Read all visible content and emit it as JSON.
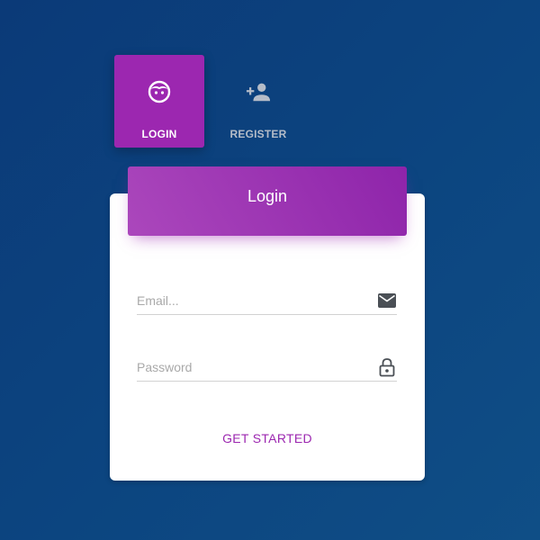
{
  "tabs": {
    "login": {
      "label": "LOGIN",
      "icon": "face-icon",
      "active": true
    },
    "register": {
      "label": "REGISTER",
      "icon": "person-add-icon",
      "active": false
    }
  },
  "card": {
    "title": "Login",
    "email": {
      "placeholder": "Email...",
      "value": "",
      "icon": "email-icon"
    },
    "password": {
      "placeholder": "Password",
      "value": "",
      "icon": "lock-icon"
    },
    "submit_label": "GET STARTED"
  },
  "colors": {
    "accent": "#9c27b0",
    "background": "#0c4580"
  }
}
